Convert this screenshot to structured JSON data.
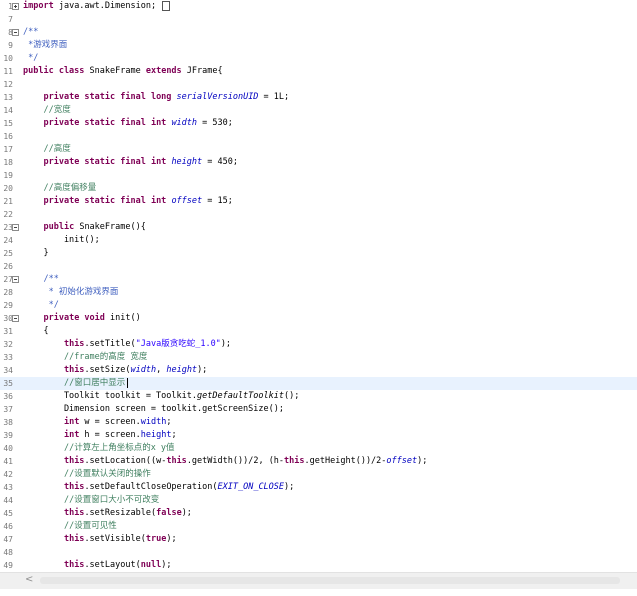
{
  "editor": {
    "lines": [
      {
        "n": "1",
        "fold": "plus",
        "tokens": [
          {
            "t": "import",
            "c": "kw"
          },
          {
            "t": " java.awt.Dimension;"
          }
        ],
        "box": true
      },
      {
        "n": "7",
        "tokens": []
      },
      {
        "n": "8",
        "fold": "minus",
        "tokens": [
          {
            "t": "/**",
            "c": "jd"
          }
        ]
      },
      {
        "n": "9",
        "tokens": [
          {
            "t": " *游戏界面",
            "c": "jd"
          }
        ]
      },
      {
        "n": "10",
        "tokens": [
          {
            "t": " */",
            "c": "jd"
          }
        ]
      },
      {
        "n": "11",
        "tokens": [
          {
            "t": "public class",
            "c": "kw"
          },
          {
            "t": " SnakeFrame "
          },
          {
            "t": "extends",
            "c": "kw"
          },
          {
            "t": " JFrame{"
          }
        ]
      },
      {
        "n": "12",
        "tokens": []
      },
      {
        "n": "13",
        "tokens": [
          {
            "t": "    "
          },
          {
            "t": "private static final long",
            "c": "kw"
          },
          {
            "t": " "
          },
          {
            "t": "serialVersionUID",
            "c": "fd it"
          },
          {
            "t": " = 1L;"
          }
        ]
      },
      {
        "n": "14",
        "tokens": [
          {
            "t": "    "
          },
          {
            "t": "//宽度",
            "c": "cm"
          }
        ]
      },
      {
        "n": "15",
        "tokens": [
          {
            "t": "    "
          },
          {
            "t": "private static final int",
            "c": "kw"
          },
          {
            "t": " "
          },
          {
            "t": "width",
            "c": "fd it"
          },
          {
            "t": " = 530;"
          }
        ]
      },
      {
        "n": "16",
        "tokens": []
      },
      {
        "n": "17",
        "tokens": [
          {
            "t": "    "
          },
          {
            "t": "//高度",
            "c": "cm"
          }
        ]
      },
      {
        "n": "18",
        "tokens": [
          {
            "t": "    "
          },
          {
            "t": "private static final int",
            "c": "kw"
          },
          {
            "t": " "
          },
          {
            "t": "height",
            "c": "fd it"
          },
          {
            "t": " = 450;"
          }
        ]
      },
      {
        "n": "19",
        "tokens": []
      },
      {
        "n": "20",
        "tokens": [
          {
            "t": "    "
          },
          {
            "t": "//高度偏移量",
            "c": "cm"
          }
        ]
      },
      {
        "n": "21",
        "tokens": [
          {
            "t": "    "
          },
          {
            "t": "private static final int",
            "c": "kw"
          },
          {
            "t": " "
          },
          {
            "t": "offset",
            "c": "fd it"
          },
          {
            "t": " = 15;"
          }
        ]
      },
      {
        "n": "22",
        "tokens": []
      },
      {
        "n": "23",
        "fold": "minus",
        "tokens": [
          {
            "t": "    "
          },
          {
            "t": "public",
            "c": "kw"
          },
          {
            "t": " SnakeFrame(){"
          }
        ]
      },
      {
        "n": "24",
        "tokens": [
          {
            "t": "        init();"
          }
        ]
      },
      {
        "n": "25",
        "tokens": [
          {
            "t": "    }"
          }
        ]
      },
      {
        "n": "26",
        "tokens": []
      },
      {
        "n": "27",
        "fold": "minus",
        "tokens": [
          {
            "t": "    "
          },
          {
            "t": "/**",
            "c": "jd"
          }
        ]
      },
      {
        "n": "28",
        "tokens": [
          {
            "t": "     * 初始化游戏界面",
            "c": "jd"
          }
        ]
      },
      {
        "n": "29",
        "tokens": [
          {
            "t": "     */",
            "c": "jd"
          }
        ]
      },
      {
        "n": "30",
        "fold": "minus",
        "tokens": [
          {
            "t": "    "
          },
          {
            "t": "private void",
            "c": "kw"
          },
          {
            "t": " init()"
          }
        ]
      },
      {
        "n": "31",
        "tokens": [
          {
            "t": "    {"
          }
        ]
      },
      {
        "n": "32",
        "tokens": [
          {
            "t": "        "
          },
          {
            "t": "this",
            "c": "kw"
          },
          {
            "t": ".setTitle("
          },
          {
            "t": "\"Java版贪吃蛇_1.0\"",
            "c": "st"
          },
          {
            "t": ");"
          }
        ]
      },
      {
        "n": "33",
        "tokens": [
          {
            "t": "        "
          },
          {
            "t": "//frame的高度 宽度",
            "c": "cm"
          }
        ]
      },
      {
        "n": "34",
        "tokens": [
          {
            "t": "        "
          },
          {
            "t": "this",
            "c": "kw"
          },
          {
            "t": ".setSize("
          },
          {
            "t": "width",
            "c": "fd it"
          },
          {
            "t": ", "
          },
          {
            "t": "height",
            "c": "fd it"
          },
          {
            "t": ");"
          }
        ]
      },
      {
        "n": "35",
        "current": true,
        "tokens": [
          {
            "t": "        "
          },
          {
            "t": "//窗口居中显示",
            "c": "cm"
          }
        ]
      },
      {
        "n": "36",
        "tokens": [
          {
            "t": "        Toolkit toolkit = Toolkit."
          },
          {
            "t": "getDefaultToolkit",
            "c": "it"
          },
          {
            "t": "();"
          }
        ]
      },
      {
        "n": "37",
        "tokens": [
          {
            "t": "        Dimension screen = toolkit.getScreenSize();"
          }
        ]
      },
      {
        "n": "38",
        "tokens": [
          {
            "t": "        "
          },
          {
            "t": "int",
            "c": "kw"
          },
          {
            "t": " w = screen."
          },
          {
            "t": "width",
            "c": "fd"
          },
          {
            "t": ";"
          }
        ]
      },
      {
        "n": "39",
        "tokens": [
          {
            "t": "        "
          },
          {
            "t": "int",
            "c": "kw"
          },
          {
            "t": " h = screen."
          },
          {
            "t": "height",
            "c": "fd"
          },
          {
            "t": ";"
          }
        ]
      },
      {
        "n": "40",
        "tokens": [
          {
            "t": "        "
          },
          {
            "t": "//计算左上角坐标点的x y值",
            "c": "cm"
          }
        ]
      },
      {
        "n": "41",
        "tokens": [
          {
            "t": "        "
          },
          {
            "t": "this",
            "c": "kw"
          },
          {
            "t": ".setLocation((w-"
          },
          {
            "t": "this",
            "c": "kw"
          },
          {
            "t": ".getWidth())/2, (h-"
          },
          {
            "t": "this",
            "c": "kw"
          },
          {
            "t": ".getHeight())/2-"
          },
          {
            "t": "offset",
            "c": "fd it"
          },
          {
            "t": ");"
          }
        ]
      },
      {
        "n": "42",
        "tokens": [
          {
            "t": "        "
          },
          {
            "t": "//设置默认关闭的操作",
            "c": "cm"
          }
        ]
      },
      {
        "n": "43",
        "tokens": [
          {
            "t": "        "
          },
          {
            "t": "this",
            "c": "kw"
          },
          {
            "t": ".setDefaultCloseOperation("
          },
          {
            "t": "EXIT_ON_CLOSE",
            "c": "fd it"
          },
          {
            "t": ");"
          }
        ]
      },
      {
        "n": "44",
        "tokens": [
          {
            "t": "        "
          },
          {
            "t": "//设置窗口大小不可改变",
            "c": "cm"
          }
        ]
      },
      {
        "n": "45",
        "tokens": [
          {
            "t": "        "
          },
          {
            "t": "this",
            "c": "kw"
          },
          {
            "t": ".setResizable("
          },
          {
            "t": "false",
            "c": "kw"
          },
          {
            "t": ");"
          }
        ]
      },
      {
        "n": "46",
        "tokens": [
          {
            "t": "        "
          },
          {
            "t": "//设置可见性",
            "c": "cm"
          }
        ]
      },
      {
        "n": "47",
        "tokens": [
          {
            "t": "        "
          },
          {
            "t": "this",
            "c": "kw"
          },
          {
            "t": ".setVisible("
          },
          {
            "t": "true",
            "c": "kw"
          },
          {
            "t": ");"
          }
        ]
      },
      {
        "n": "48",
        "tokens": []
      },
      {
        "n": "49",
        "tokens": [
          {
            "t": "        "
          },
          {
            "t": "this",
            "c": "kw"
          },
          {
            "t": ".setLayout("
          },
          {
            "t": "null",
            "c": "kw"
          },
          {
            "t": ");"
          }
        ]
      }
    ]
  },
  "scrollbar": {
    "left_arrow": "<"
  },
  "colors": {
    "keyword": "#7f0055",
    "comment": "#3f7f5f",
    "javadoc": "#3f5fbf",
    "field": "#0000c0",
    "string": "#2a00ff",
    "current_line": "#e8f2fe"
  }
}
